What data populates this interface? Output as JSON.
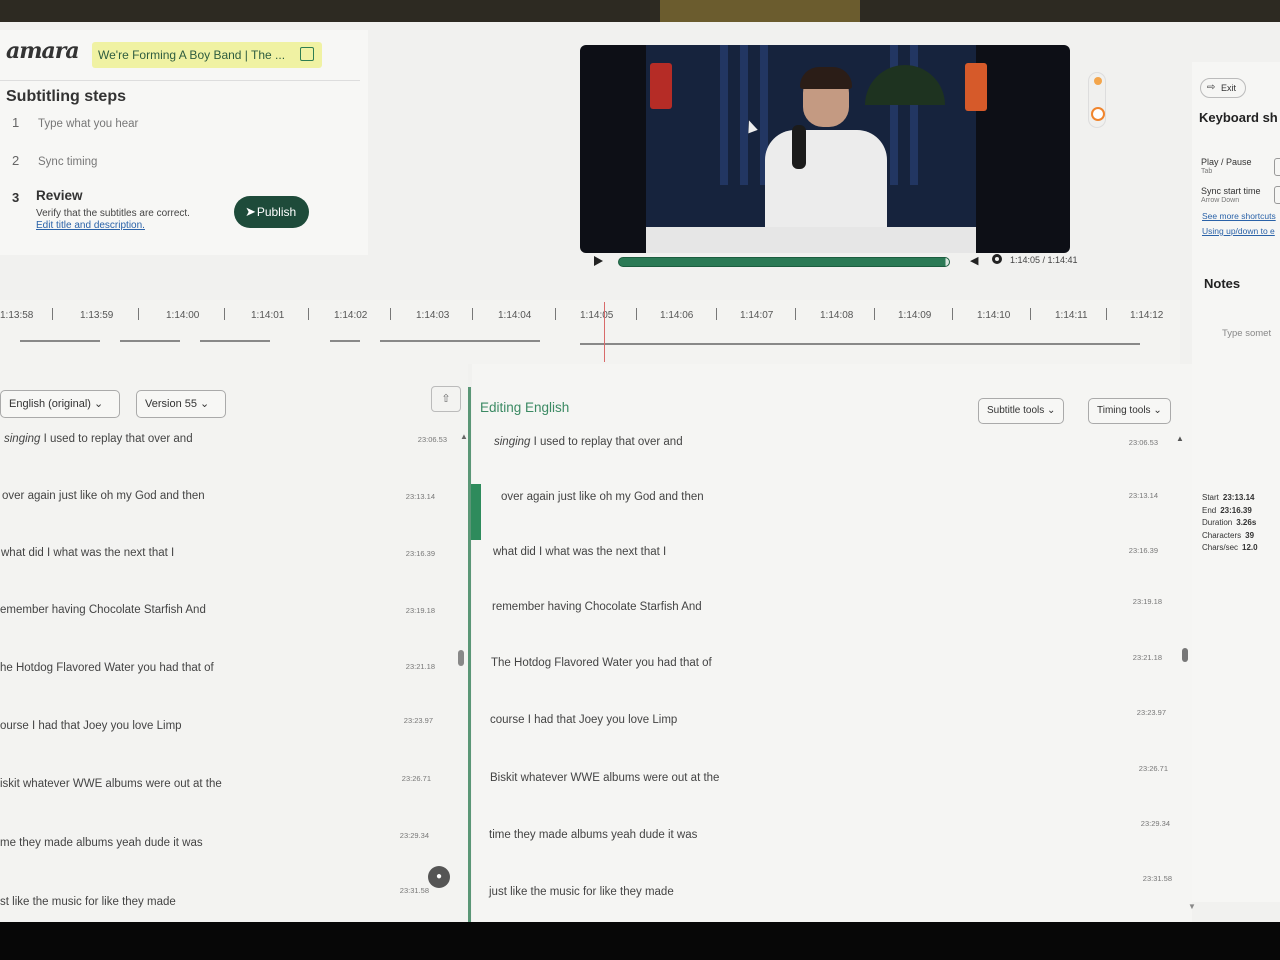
{
  "header": {
    "logo": "amara",
    "video_title": "We're Forming A Boy Band | The ..."
  },
  "steps": {
    "title": "Subtitling steps",
    "items": [
      {
        "number": "1",
        "label": "Type what you hear"
      },
      {
        "number": "2",
        "label": "Sync timing"
      },
      {
        "number": "3",
        "label": "Review",
        "description": "Verify that the subtitles are correct.",
        "link": "Edit title and description."
      }
    ],
    "publish_label": "Publish"
  },
  "player": {
    "time": "1:14:05 / 1:14:41",
    "progress_fraction": 0.99
  },
  "sidebar": {
    "exit_label": "Exit",
    "shortcuts_title": "Keyboard sh",
    "shortcuts": [
      {
        "label": "Play / Pause",
        "key": "Tab"
      },
      {
        "label": "Sync start time",
        "key": "Arrow Down"
      }
    ],
    "links": [
      "See more shortcuts",
      "Using up/down to e"
    ],
    "notes_title": "Notes",
    "notes_placeholder": "Type somet",
    "stats": {
      "start_label": "Start",
      "start": "23:13.14",
      "end_label": "End",
      "end": "23:16.39",
      "duration_label": "Duration",
      "duration": "3.26s",
      "characters_label": "Characters",
      "characters": "39",
      "cps_label": "Chars/sec",
      "cps": "12.0"
    }
  },
  "timeline": {
    "ticks": [
      "1:13:58",
      "1:13:59",
      "1:14:00",
      "1:14:01",
      "1:14:02",
      "1:14:03",
      "1:14:04",
      "1:14:05",
      "1:14:06",
      "1:14:07",
      "1:14:08",
      "1:14:09",
      "1:14:10",
      "1:14:11",
      "1:14:12"
    ]
  },
  "reference": {
    "language": "English (original)",
    "version": "Version 55",
    "rows": [
      {
        "prefix": "singing",
        "text": " I used to replay that over and",
        "time": "23:06.53"
      },
      {
        "prefix": "",
        "text": "over again just like oh my God and then",
        "time": "23:13.14"
      },
      {
        "prefix": "",
        "text": "what did I what was the next that I",
        "time": "23:16.39"
      },
      {
        "prefix": "",
        "text": "emember having Chocolate Starfish And",
        "time": "23:19.18"
      },
      {
        "prefix": "",
        "text": "he Hotdog Flavored Water you had that of",
        "time": "23:21.18"
      },
      {
        "prefix": "",
        "text": "ourse I had that Joey you love Limp",
        "time": "23:23.97"
      },
      {
        "prefix": "",
        "text": "iskit whatever WWE albums were out at the",
        "time": "23:26.71"
      },
      {
        "prefix": "",
        "text": "me they made albums yeah dude it was",
        "time": "23:29.34"
      },
      {
        "prefix": "",
        "text": "st like the music for like they made",
        "time": "23:31.58"
      }
    ]
  },
  "editor": {
    "title": "Editing English",
    "subtitle_tools": "Subtitle tools",
    "timing_tools": "Timing tools",
    "rows": [
      {
        "prefix": "singing",
        "text": " I used to replay that over and",
        "time": "23:06.53"
      },
      {
        "prefix": "",
        "text": "over again just like oh my God and then",
        "time": "23:13.14"
      },
      {
        "prefix": "",
        "text": "what did I what was the next that I",
        "time": "23:16.39"
      },
      {
        "prefix": "",
        "text": "remember having Chocolate Starfish And",
        "time": "23:19.18"
      },
      {
        "prefix": "",
        "text": "The Hotdog Flavored Water you had that of",
        "time": "23:21.18"
      },
      {
        "prefix": "",
        "text": "course I had that Joey you love Limp",
        "time": "23:23.97"
      },
      {
        "prefix": "",
        "text": "Biskit whatever WWE albums were out at the",
        "time": "23:26.71"
      },
      {
        "prefix": "",
        "text": "time they made albums yeah dude it was",
        "time": "23:29.34"
      },
      {
        "prefix": "",
        "text": "just like the music for like they made",
        "time": "23:31.58"
      }
    ]
  },
  "colors": {
    "accent_green": "#1e4b3a",
    "editing_green": "#3b8a63",
    "title_highlight": "#f0f2a3"
  }
}
